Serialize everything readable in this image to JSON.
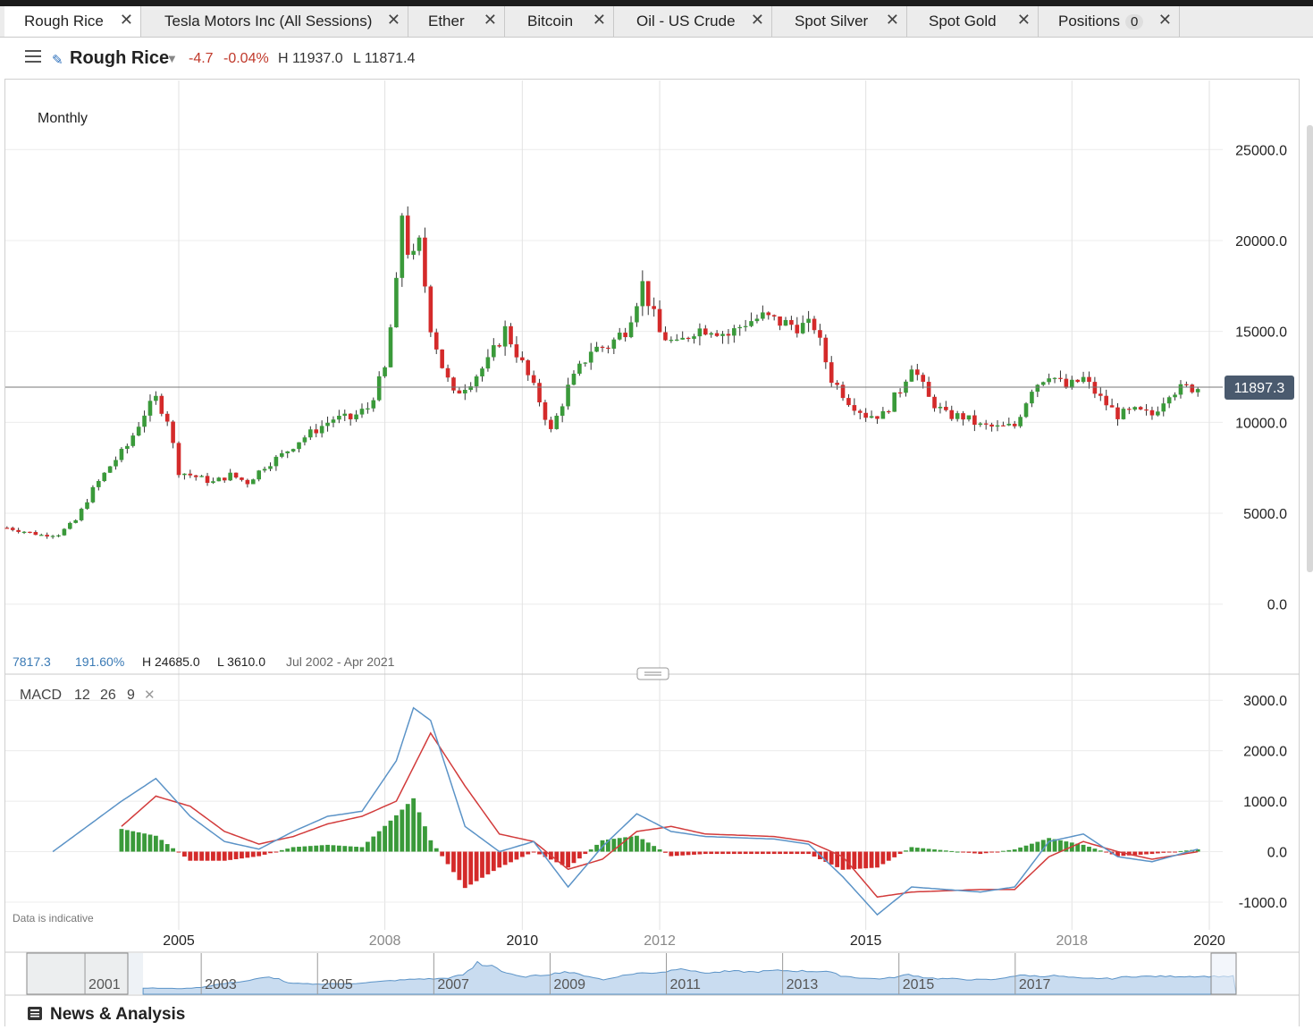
{
  "tabs": [
    {
      "label": "Rough Rice",
      "close": "✕",
      "active": true
    },
    {
      "label": "Tesla Motors Inc (All Sessions)",
      "close": "✕"
    },
    {
      "label": "Ether",
      "close": "✕"
    },
    {
      "label": "Bitcoin",
      "close": "✕"
    },
    {
      "label": "Oil - US Crude",
      "close": "✕"
    },
    {
      "label": "Spot Silver",
      "close": "✕"
    },
    {
      "label": "Spot Gold",
      "close": "✕"
    },
    {
      "label": "Positions",
      "badge": "0",
      "close": "✕"
    }
  ],
  "header": {
    "instrument": "Rough Rice",
    "change": "-4.7",
    "change_pct": "-0.04%",
    "high": "H 11937.0",
    "low": "L 11871.4"
  },
  "price_panel": {
    "interval": "Monthly",
    "current_price": "11897.3",
    "stats": {
      "change": "7817.3",
      "pct": "191.60%",
      "high": "H 24685.0",
      "low": "L 3610.0",
      "range": "Jul 2002 - Apr 2021"
    }
  },
  "macd_panel": {
    "label": "MACD",
    "fast": "12",
    "slow": "26",
    "signal": "9",
    "close": "✕"
  },
  "footer": {
    "disclaimer": "Data is indicative",
    "news": "News & Analysis"
  },
  "navigator": {
    "labels": [
      "2001",
      "2003",
      "2005",
      "2007",
      "2009",
      "2011",
      "2013",
      "2015",
      "2017"
    ]
  },
  "colors": {
    "up": "#3a9a3a",
    "down": "#d42a2a",
    "macd_line": "#5b93c7",
    "signal_line": "#d23b3b",
    "price_label_bg": "#4a5a6e"
  },
  "chart_data": [
    {
      "type": "candlestick",
      "name": "Rough Rice",
      "interval": "Monthly",
      "x_tick_labels": [
        "2005",
        "2008",
        "2010",
        "2012",
        "2015",
        "2018",
        "2020"
      ],
      "y_tick_labels": [
        "25000.0",
        "20000.0",
        "15000.0",
        "10000.0",
        "5000.0",
        "0.0"
      ],
      "ylim": [
        -3800,
        28800
      ],
      "close_series": [
        [
          "2002-07",
          4200
        ],
        [
          "2002-10",
          4000
        ],
        [
          "2003-01",
          3800
        ],
        [
          "2003-04",
          3850
        ],
        [
          "2003-07",
          4600
        ],
        [
          "2003-10",
          6300
        ],
        [
          "2004-01",
          7600
        ],
        [
          "2004-04",
          8700
        ],
        [
          "2004-07",
          10500
        ],
        [
          "2004-09",
          11300
        ],
        [
          "2004-11",
          10200
        ],
        [
          "2005-01",
          7300
        ],
        [
          "2005-04",
          7000
        ],
        [
          "2005-07",
          6700
        ],
        [
          "2005-10",
          7100
        ],
        [
          "2006-01",
          6700
        ],
        [
          "2006-04",
          7600
        ],
        [
          "2006-07",
          8200
        ],
        [
          "2006-10",
          9000
        ],
        [
          "2007-01",
          9600
        ],
        [
          "2007-04",
          10200
        ],
        [
          "2007-07",
          10200
        ],
        [
          "2007-10",
          10800
        ],
        [
          "2008-01",
          12900
        ],
        [
          "2008-03",
          17500
        ],
        [
          "2008-04",
          21500
        ],
        [
          "2008-05",
          19500
        ],
        [
          "2008-06",
          19000
        ],
        [
          "2008-07",
          19800
        ],
        [
          "2008-09",
          15300
        ],
        [
          "2008-11",
          13100
        ],
        [
          "2009-01",
          11500
        ],
        [
          "2009-04",
          12300
        ],
        [
          "2009-07",
          13300
        ],
        [
          "2009-10",
          15100
        ],
        [
          "2010-01",
          13200
        ],
        [
          "2010-04",
          11200
        ],
        [
          "2010-06",
          9500
        ],
        [
          "2010-09",
          11900
        ],
        [
          "2011-01",
          14000
        ],
        [
          "2011-04",
          14200
        ],
        [
          "2011-07",
          15100
        ],
        [
          "2011-10",
          17600
        ],
        [
          "2012-01",
          14900
        ],
        [
          "2012-04",
          14200
        ],
        [
          "2012-07",
          15100
        ],
        [
          "2012-10",
          15200
        ],
        [
          "2013-01",
          14800
        ],
        [
          "2013-04",
          15500
        ],
        [
          "2013-07",
          15800
        ],
        [
          "2013-10",
          15500
        ],
        [
          "2014-01",
          15300
        ],
        [
          "2014-04",
          15300
        ],
        [
          "2014-07",
          12400
        ],
        [
          "2014-10",
          11200
        ],
        [
          "2015-01",
          10400
        ],
        [
          "2015-04",
          10400
        ],
        [
          "2015-07",
          11800
        ],
        [
          "2015-09",
          13200
        ],
        [
          "2015-12",
          11300
        ],
        [
          "2016-03",
          10400
        ],
        [
          "2016-06",
          10300
        ],
        [
          "2016-09",
          9800
        ],
        [
          "2016-12",
          9700
        ],
        [
          "2017-03",
          9800
        ],
        [
          "2017-06",
          11900
        ],
        [
          "2017-09",
          12700
        ],
        [
          "2017-12",
          11900
        ],
        [
          "2018-03",
          12400
        ],
        [
          "2018-06",
          11300
        ],
        [
          "2018-09",
          10400
        ],
        [
          "2018-12",
          10600
        ],
        [
          "2019-03",
          10400
        ],
        [
          "2019-06",
          11700
        ],
        [
          "2019-09",
          11900
        ],
        [
          "2019-11",
          11897
        ]
      ]
    },
    {
      "type": "line",
      "name": "MACD 12 26 9",
      "y_tick_labels": [
        "3000.0",
        "2000.0",
        "1000.0",
        "0.0",
        "-1000.0"
      ],
      "ylim": [
        -1550,
        3500
      ],
      "macd": [
        [
          "2003-03",
          0
        ],
        [
          "2003-09",
          500
        ],
        [
          "2004-03",
          1000
        ],
        [
          "2004-09",
          1450
        ],
        [
          "2005-03",
          700
        ],
        [
          "2005-09",
          200
        ],
        [
          "2006-03",
          50
        ],
        [
          "2006-09",
          400
        ],
        [
          "2007-03",
          700
        ],
        [
          "2007-09",
          800
        ],
        [
          "2008-03",
          1800
        ],
        [
          "2008-06",
          2850
        ],
        [
          "2008-09",
          2600
        ],
        [
          "2009-03",
          500
        ],
        [
          "2009-09",
          0
        ],
        [
          "2010-03",
          200
        ],
        [
          "2010-09",
          -700
        ],
        [
          "2011-03",
          100
        ],
        [
          "2011-09",
          750
        ],
        [
          "2012-03",
          400
        ],
        [
          "2012-09",
          300
        ],
        [
          "2013-09",
          250
        ],
        [
          "2014-03",
          150
        ],
        [
          "2014-09",
          -500
        ],
        [
          "2015-03",
          -1250
        ],
        [
          "2015-09",
          -700
        ],
        [
          "2016-03",
          -750
        ],
        [
          "2016-09",
          -800
        ],
        [
          "2017-03",
          -700
        ],
        [
          "2017-09",
          200
        ],
        [
          "2018-03",
          350
        ],
        [
          "2018-09",
          -100
        ],
        [
          "2019-03",
          -200
        ],
        [
          "2019-11",
          50
        ]
      ],
      "signal": [
        [
          "2004-03",
          500
        ],
        [
          "2004-09",
          1100
        ],
        [
          "2005-03",
          900
        ],
        [
          "2005-09",
          400
        ],
        [
          "2006-03",
          150
        ],
        [
          "2006-09",
          300
        ],
        [
          "2007-03",
          550
        ],
        [
          "2007-09",
          700
        ],
        [
          "2008-03",
          1000
        ],
        [
          "2008-09",
          2350
        ],
        [
          "2009-03",
          1300
        ],
        [
          "2009-09",
          350
        ],
        [
          "2010-03",
          200
        ],
        [
          "2010-09",
          -350
        ],
        [
          "2011-03",
          -150
        ],
        [
          "2011-09",
          400
        ],
        [
          "2012-03",
          500
        ],
        [
          "2012-09",
          350
        ],
        [
          "2013-09",
          300
        ],
        [
          "2014-03",
          200
        ],
        [
          "2014-09",
          -100
        ],
        [
          "2015-03",
          -900
        ],
        [
          "2015-09",
          -800
        ],
        [
          "2016-09",
          -750
        ],
        [
          "2017-03",
          -750
        ],
        [
          "2017-09",
          -100
        ],
        [
          "2018-03",
          200
        ],
        [
          "2018-09",
          0
        ],
        [
          "2019-03",
          -150
        ],
        [
          "2019-11",
          0
        ]
      ],
      "histogram_note": "histogram = macd - signal"
    }
  ]
}
